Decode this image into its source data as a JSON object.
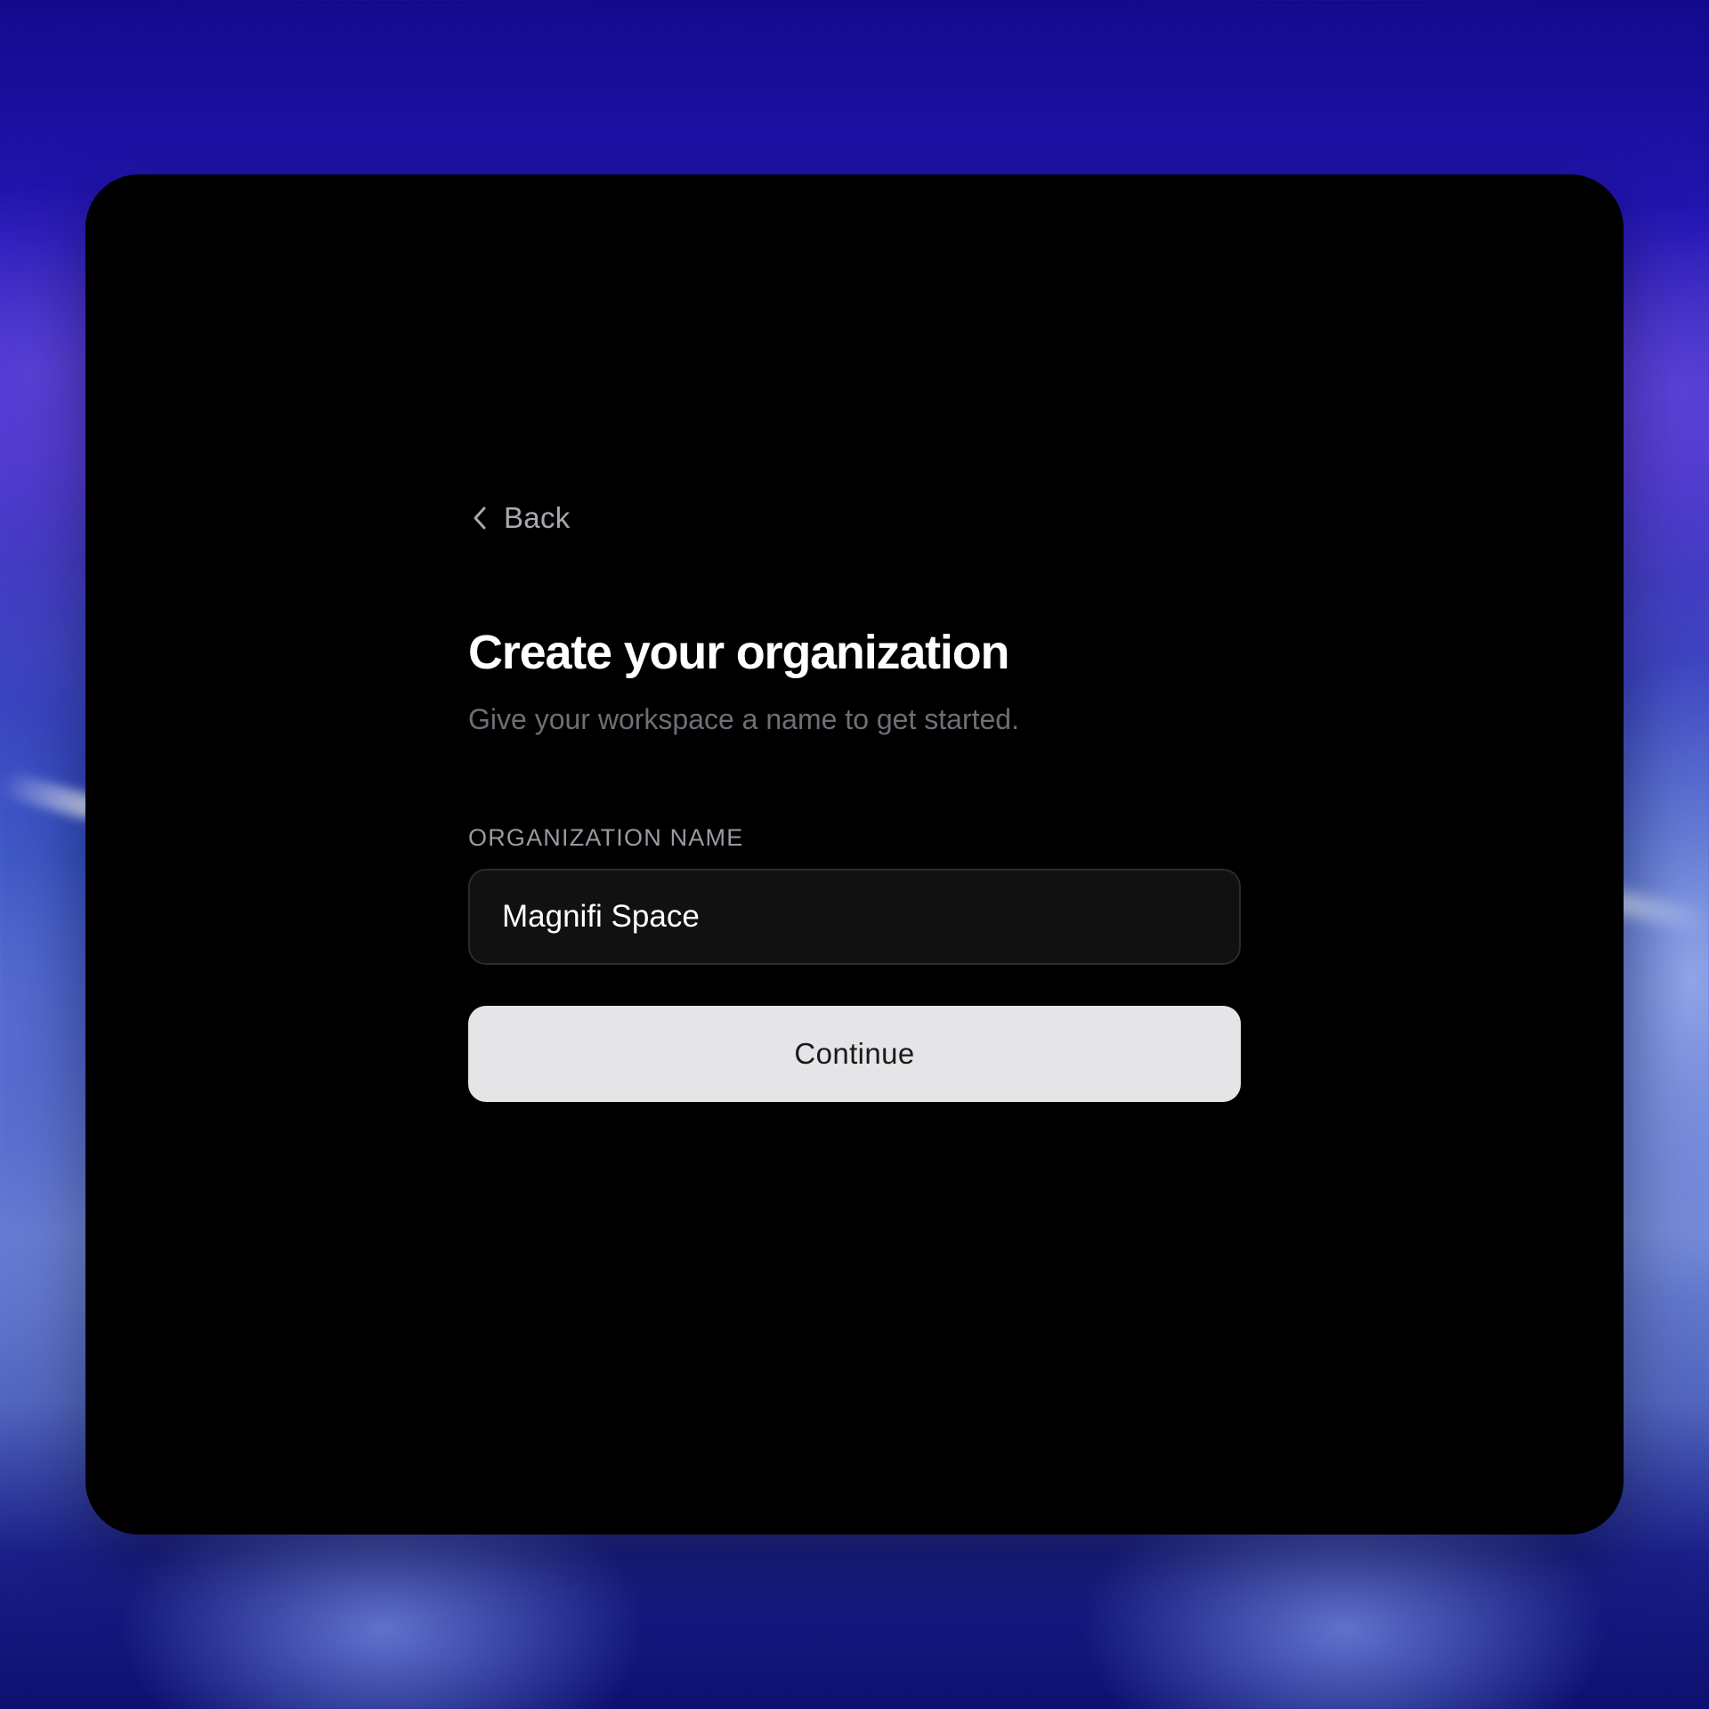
{
  "back": {
    "icon": "chevron-left-icon",
    "label": "Back"
  },
  "header": {
    "title": "Create your organization",
    "subtitle": "Give your workspace a name to get started."
  },
  "form": {
    "org_name_label": "ORGANIZATION NAME",
    "org_name_value": "Magnifi Space",
    "continue_label": "Continue"
  },
  "colors": {
    "card_background": "#000000",
    "input_background": "#111112",
    "button_background": "#e5e5e7",
    "title_text": "#ffffff",
    "subtitle_text": "#6e6e76"
  }
}
